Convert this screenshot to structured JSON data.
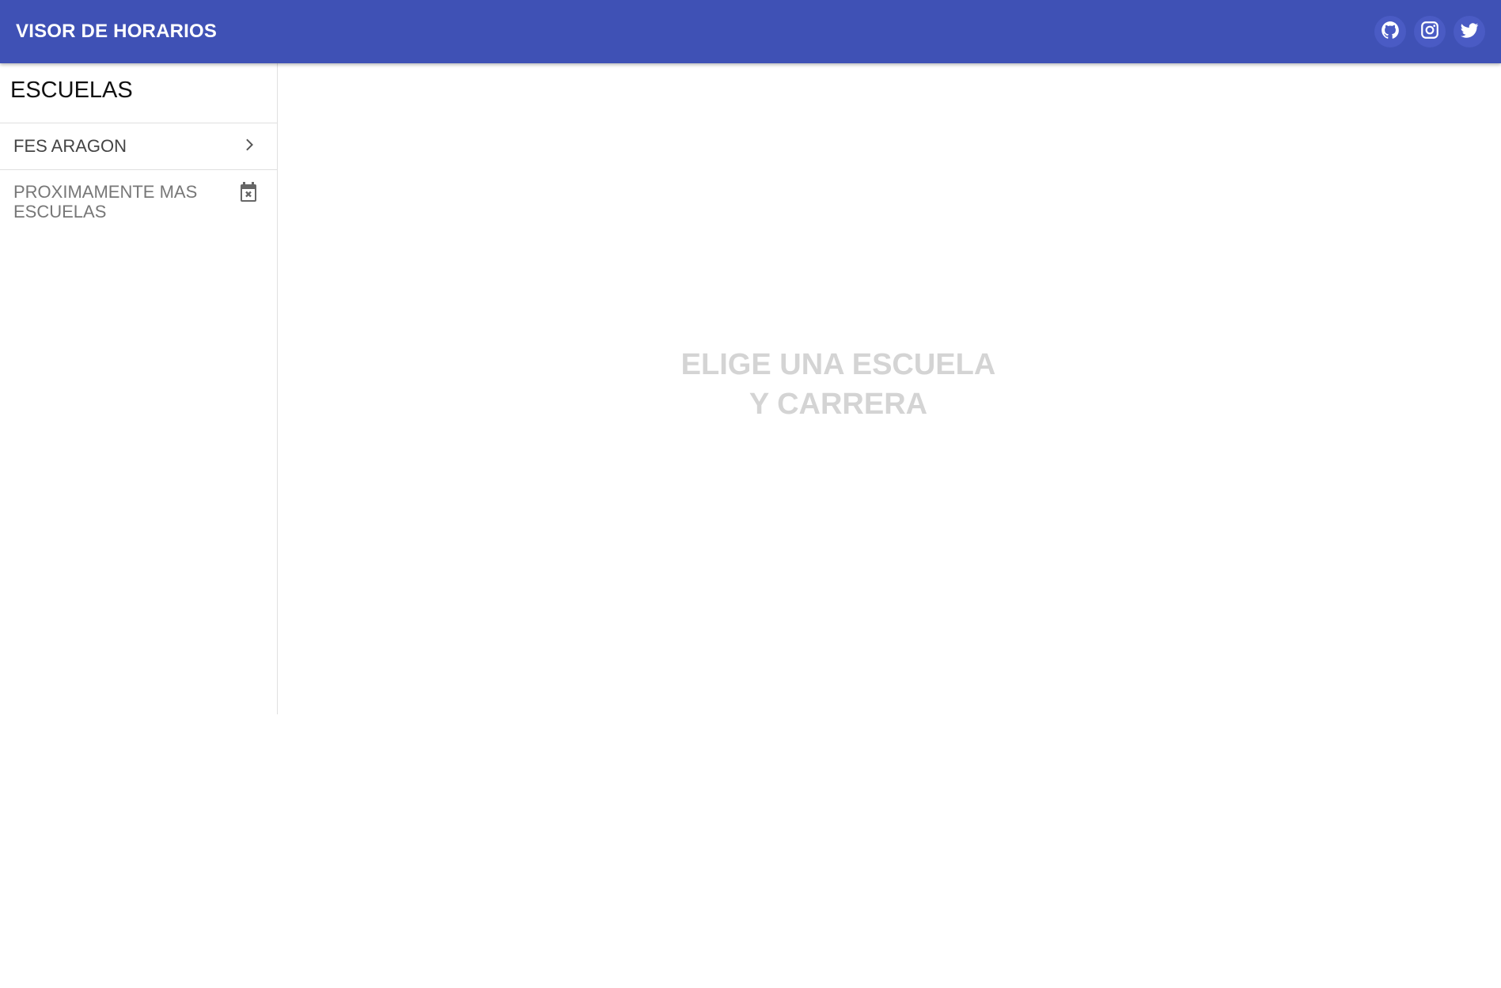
{
  "header": {
    "title": "VISOR DE HORARIOS",
    "social": [
      {
        "icon": "github-icon"
      },
      {
        "icon": "instagram-icon"
      },
      {
        "icon": "twitter-icon"
      }
    ],
    "color": "#3f51b5"
  },
  "sidebar": {
    "title": "ESCUELAS",
    "items": [
      {
        "label": "FES ARAGON",
        "icon": "chevron-right-icon"
      },
      {
        "label": "PROXIMAMENTE MAS ESCUELAS",
        "icon": "calendar-remove-icon"
      }
    ]
  },
  "main": {
    "placeholder_line1": "ELIGE UNA ESCUELA",
    "placeholder_line2": "Y CARRERA"
  }
}
